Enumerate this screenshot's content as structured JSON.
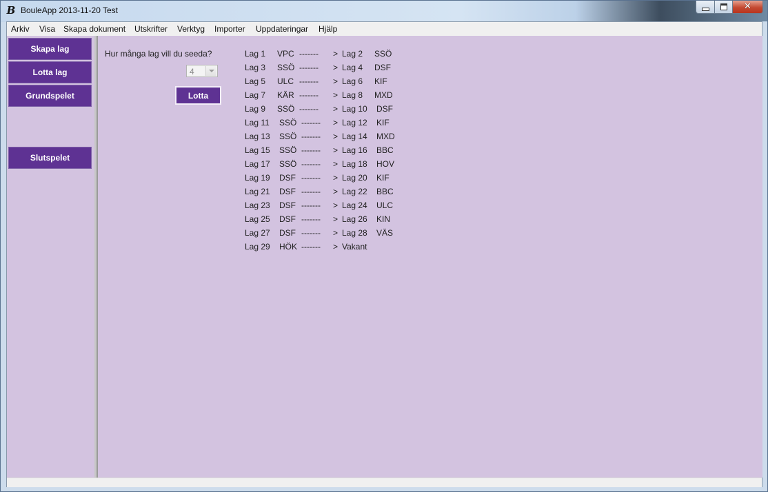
{
  "window": {
    "icon_glyph": "B",
    "title": "BouleApp 2013-11-20 Test",
    "buttons": {
      "minimize": "minimize-icon",
      "maximize": "maximize-icon",
      "close": "close-icon"
    }
  },
  "menu": [
    "Arkiv",
    "Visa",
    "Skapa dokument",
    "Utskrifter",
    "Verktyg",
    "Importer",
    "Uppdateringar",
    "Hjälp"
  ],
  "sidebar": {
    "skapa_lag": "Skapa lag",
    "lotta_lag": "Lotta lag",
    "grundspelet": "Grundspelet",
    "slutspelet": "Slutspelet"
  },
  "seed": {
    "question": "Hur många lag vill du seeda?",
    "value": "4",
    "button": "Lotta"
  },
  "pairs": [
    {
      "lag_a": "Lag 1",
      "club_a": "VPC",
      "sep": "-------",
      "arrow": ">",
      "lag_b": "Lag 2",
      "club_b": "SSÖ"
    },
    {
      "lag_a": "Lag 3",
      "club_a": "SSÖ",
      "sep": "-------",
      "arrow": ">",
      "lag_b": "Lag 4",
      "club_b": "DSF"
    },
    {
      "lag_a": "Lag 5",
      "club_a": "ULC",
      "sep": "-------",
      "arrow": ">",
      "lag_b": "Lag 6",
      "club_b": "KIF"
    },
    {
      "lag_a": "Lag 7",
      "club_a": "KÄR",
      "sep": "-------",
      "arrow": ">",
      "lag_b": "Lag 8",
      "club_b": "MXD"
    },
    {
      "lag_a": "Lag 9",
      "club_a": "SSÖ",
      "sep": "-------",
      "arrow": ">",
      "lag_b": "Lag 10",
      "club_b": "DSF"
    },
    {
      "lag_a": "Lag 11",
      "club_a": "SSÖ",
      "sep": "-------",
      "arrow": ">",
      "lag_b": "Lag 12",
      "club_b": "KIF"
    },
    {
      "lag_a": "Lag 13",
      "club_a": "SSÖ",
      "sep": "-------",
      "arrow": ">",
      "lag_b": "Lag 14",
      "club_b": "MXD"
    },
    {
      "lag_a": "Lag 15",
      "club_a": "SSÖ",
      "sep": "-------",
      "arrow": ">",
      "lag_b": "Lag 16",
      "club_b": "BBC"
    },
    {
      "lag_a": "Lag 17",
      "club_a": "SSÖ",
      "sep": "-------",
      "arrow": ">",
      "lag_b": "Lag 18",
      "club_b": "HOV"
    },
    {
      "lag_a": "Lag 19",
      "club_a": "DSF",
      "sep": "-------",
      "arrow": ">",
      "lag_b": "Lag 20",
      "club_b": "KIF"
    },
    {
      "lag_a": "Lag 21",
      "club_a": "DSF",
      "sep": "-------",
      "arrow": ">",
      "lag_b": "Lag 22",
      "club_b": "BBC"
    },
    {
      "lag_a": "Lag 23",
      "club_a": "DSF",
      "sep": "-------",
      "arrow": ">",
      "lag_b": "Lag 24",
      "club_b": "ULC"
    },
    {
      "lag_a": "Lag 25",
      "club_a": "DSF",
      "sep": "-------",
      "arrow": ">",
      "lag_b": "Lag 26",
      "club_b": "KIN"
    },
    {
      "lag_a": "Lag 27",
      "club_a": "DSF",
      "sep": "-------",
      "arrow": ">",
      "lag_b": "Lag 28",
      "club_b": "VÄS"
    },
    {
      "lag_a": "Lag 29",
      "club_a": "HÖK",
      "sep": "-------",
      "arrow": ">",
      "lag_b": "Vakant",
      "club_b": ""
    }
  ],
  "colors": {
    "button_bg": "#5e3293",
    "panel_bg": "#d3c3e0"
  }
}
